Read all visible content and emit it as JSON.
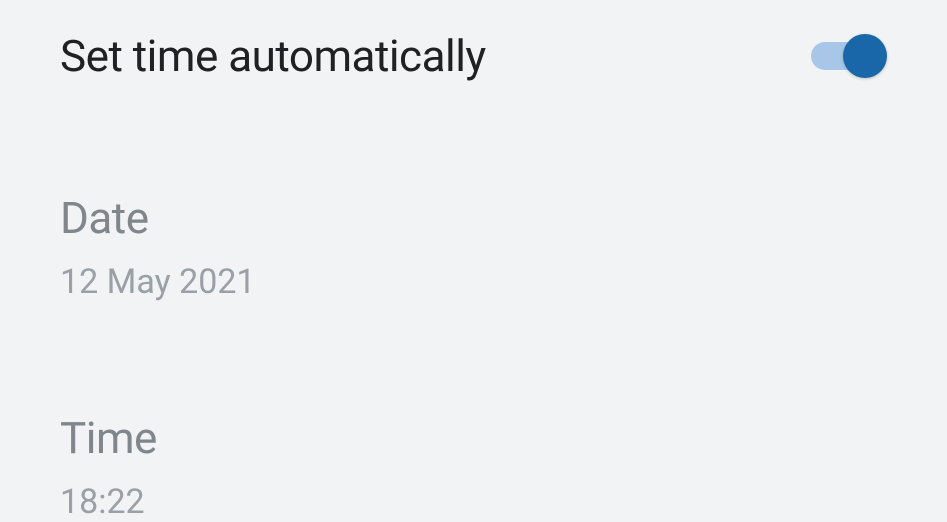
{
  "autoTime": {
    "label": "Set time automatically",
    "enabled": true
  },
  "date": {
    "title": "Date",
    "value": "12 May 2021"
  },
  "time": {
    "title": "Time",
    "value": "18:22"
  }
}
